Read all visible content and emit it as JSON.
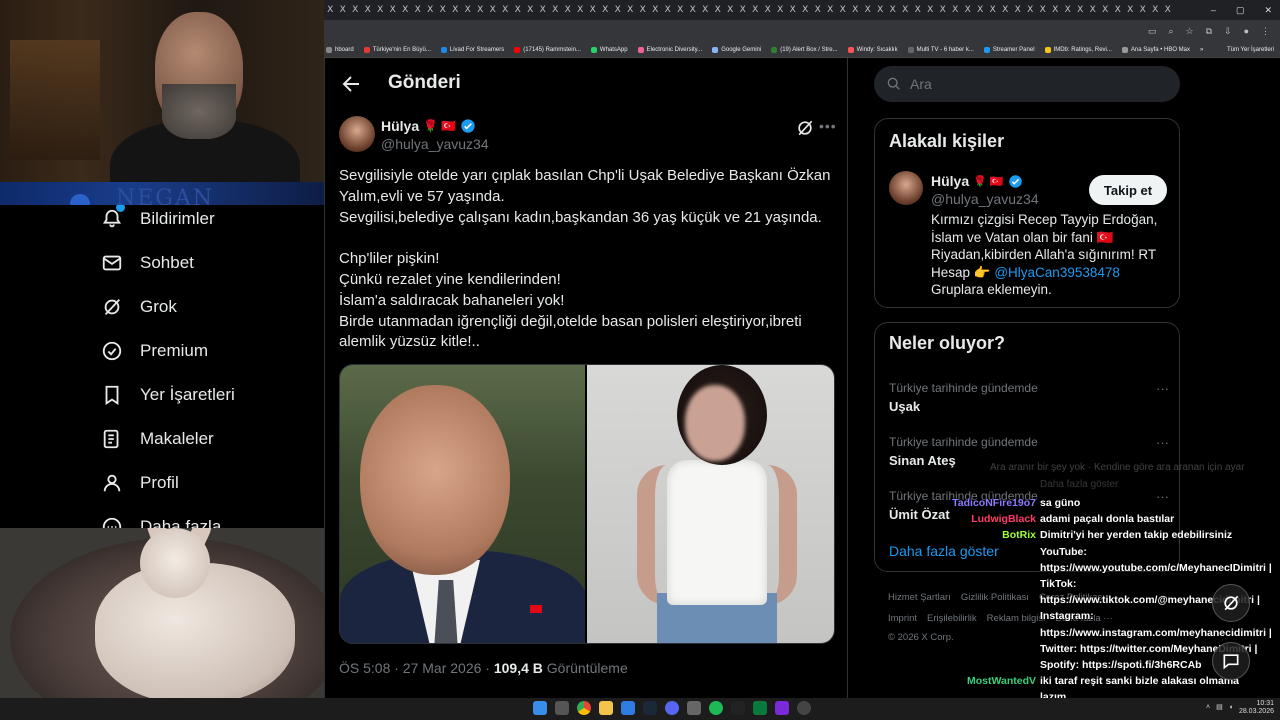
{
  "browser": {
    "tab_glyph": "X",
    "window_controls": [
      "–",
      "▢",
      "✕"
    ],
    "bookmarks": [
      "hboard",
      "Türkiye'nin En Büyü...",
      "Livad For Streamers",
      "(17145) Rammstein...",
      "WhatsApp",
      "Electronic Diversity...",
      "Google Gemini",
      "(19) Alert Box / Stre...",
      "Windy: Sıcaklık",
      "Multi TV - 6 haber k...",
      "Streamer Panel",
      "IMDb: Ratings, Revi...",
      "Ana Sayfa • HBO Max"
    ],
    "bookmarks_more": "»",
    "bookmarks_all": "Tüm Yer İşaretleri"
  },
  "webcam": {
    "logo": "NEGAN"
  },
  "leftnav": {
    "items": [
      {
        "label": "Bildirimler",
        "icon": "bell-icon"
      },
      {
        "label": "Sohbet",
        "icon": "mail-icon"
      },
      {
        "label": "Grok",
        "icon": "grok-icon"
      },
      {
        "label": "Premium",
        "icon": "verified-icon"
      },
      {
        "label": "Yer İşaretleri",
        "icon": "bookmark-icon"
      },
      {
        "label": "Makaleler",
        "icon": "article-icon"
      },
      {
        "label": "Profil",
        "icon": "person-icon"
      },
      {
        "label": "Daha fazla",
        "icon": "more-circle-icon"
      }
    ]
  },
  "main": {
    "title": "Gönderi",
    "post": {
      "name": "Hülya",
      "name_emojis": "🌹 🇹🇷",
      "handle": "@hulya_yavuz34",
      "lines": [
        "Sevgilisiyle otelde yarı çıplak basılan Chp'li Uşak Belediye Başkanı Özkan",
        "Yalım,evli ve 57 yaşında.",
        "Sevgilisi,belediye çalışanı kadın,başkandan 36 yaş küçük ve 21 yaşında.",
        "",
        "Chp'liler pişkin!",
        "Çünkü rezalet yine kendilerinden!",
        "İslam'a saldıracak bahaneleri yok!",
        "Birde utanmadan iğrençliği değil,otelde basan polisleri eleştiriyor,ibreti",
        "alemlik yüzsüz kitle!.."
      ],
      "time": "ÖS 5:08 · 27 Mar 2026 · ",
      "views_value": "109,4 B",
      "views_label": " Görüntüleme"
    }
  },
  "right": {
    "search_placeholder": "Ara",
    "related": {
      "title": "Alakalı kişiler",
      "name": "Hülya",
      "name_emojis": "🌹 🇹🇷",
      "handle": "@hulya_yavuz34",
      "follow": "Takip et",
      "bio_1": "Kırmızı çizgisi Recep Tayyip Erdoğan, İslam ve Vatan olan bir fani 🇹🇷 Riyadan,kibirden Allah'a sığınırım! RT Hesap 👉 ",
      "bio_mention": "@HlyaCan39538478",
      "bio_2": "Gruplara eklemeyin."
    },
    "trends": {
      "title": "Neler oluyor?",
      "items": [
        {
          "label": "Türkiye tarihinde gündemde",
          "topic": "Uşak"
        },
        {
          "label": "Türkiye tarihinde gündemde",
          "topic": "Sinan Ateş"
        },
        {
          "label": "Türkiye tarihinde gündemde",
          "topic": "Ümit Özat"
        }
      ],
      "more_glyph": "···",
      "show_more": "Daha fazla göster"
    },
    "footer_1": [
      "Hizmet Şartları",
      "Gizlilik Politikası",
      "Çerez Politikası"
    ],
    "footer_2": [
      "Imprint",
      "Erişilebilirlik",
      "Reklam bilgisi",
      "Daha fazla ···"
    ],
    "copyright": "© 2026 X Corp."
  },
  "chat": {
    "ghost_1": "Ara aranır bir şey yok · Kendine göre ara aranan için ayar",
    "ghost_2": "Daha fazla göster",
    "messages": [
      {
        "user": "TadicoNFire19o7",
        "color": "#8a7dff",
        "text": "sa güno"
      },
      {
        "user": "LudwigBlack",
        "color": "#ff3b6b",
        "text": "adami paçalı donla bastılar"
      },
      {
        "user": "BotRix",
        "color": "#9cff3a",
        "text": "Dimitri'yi her yerden takip edebilirsiniz"
      },
      {
        "user": "",
        "color": "#fff",
        "text": "YouTube:"
      },
      {
        "user": "",
        "color": "#fff",
        "text": "https://www.youtube.com/c/MeyhanecIDimitri |"
      },
      {
        "user": "",
        "color": "#fff",
        "text": "TikTok:"
      },
      {
        "user": "",
        "color": "#fff",
        "text": "https://www.tiktok.com/@meyhanecidimitri |"
      },
      {
        "user": "",
        "color": "#fff",
        "text": "Instagram:"
      },
      {
        "user": "",
        "color": "#fff",
        "text": "https://www.instagram.com/meyhanecidimitri |"
      },
      {
        "user": "",
        "color": "#fff",
        "text": "Twitter: https://twitter.com/MeyhaneDimitri |"
      },
      {
        "user": "",
        "color": "#fff",
        "text": "Spotify: https://spoti.fi/3h6RCAb"
      },
      {
        "user": "MostWantedV",
        "color": "#3ad07a",
        "text": "iki taraf reşit sanki bizle alakası olmama"
      },
      {
        "user": "",
        "color": "#fff",
        "text": "lazım"
      }
    ]
  },
  "taskbar": {
    "time": "10:31",
    "date": "28.03.2026"
  }
}
